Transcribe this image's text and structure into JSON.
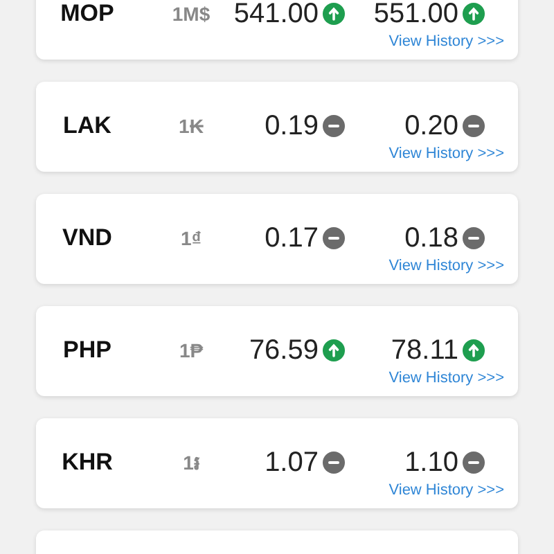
{
  "rates": [
    {
      "code": "MOP",
      "unit": "1M$",
      "buy": {
        "value": "541.00",
        "rising": true
      },
      "sell": {
        "value": "551.00",
        "rising": true
      },
      "link": "View History >>>"
    },
    {
      "code": "LAK",
      "unit": "1₭",
      "buy": {
        "value": "0.19",
        "rising": false
      },
      "sell": {
        "value": "0.20",
        "rising": false
      },
      "link": "View History >>>"
    },
    {
      "code": "VND",
      "unit": "1₫",
      "buy": {
        "value": "0.17",
        "rising": false
      },
      "sell": {
        "value": "0.18",
        "rising": false
      },
      "link": "View History >>>"
    },
    {
      "code": "PHP",
      "unit": "1₱",
      "buy": {
        "value": "76.59",
        "rising": true
      },
      "sell": {
        "value": "78.11",
        "rising": true
      },
      "link": "View History >>>"
    },
    {
      "code": "KHR",
      "unit": "1៛",
      "buy": {
        "value": "1.07",
        "rising": false
      },
      "sell": {
        "value": "1.10",
        "rising": false
      },
      "link": "View History >>>"
    }
  ]
}
